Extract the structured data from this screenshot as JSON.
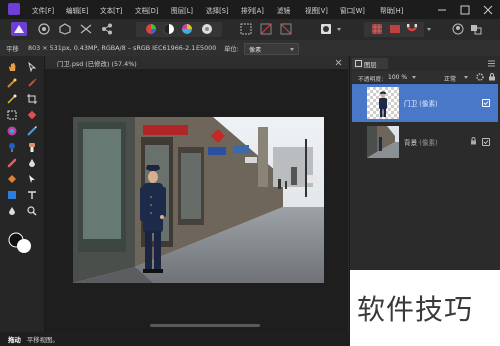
{
  "menubar": {
    "items": [
      "文件[F]",
      "编辑[E]",
      "文本[T]",
      "文档[D]",
      "图层[L]",
      "选择[S]",
      "排列[A]",
      "滤镜",
      "视图[V]",
      "窗口[W]",
      "帮助[H]"
    ]
  },
  "context_bar": {
    "tool_label": "平移",
    "doc_info": "803 × 531px, 0.43MP, RGBA/8 – sRGB IEC61966-2.1",
    "camera": "E5000",
    "units_label": "单位:",
    "units_value": "像素"
  },
  "document": {
    "tab_title": "门卫.psd (已修改) (57.4%)"
  },
  "layers_panel": {
    "tab_label": "图层",
    "opacity_label": "不透明度:",
    "opacity_value": "100 %",
    "blend_mode": "正常",
    "layers": [
      {
        "name": "门卫",
        "type": "(像素)",
        "selected": true
      },
      {
        "name": "背景",
        "type": "(像素)",
        "selected": false
      }
    ]
  },
  "statusbar": {
    "tool": "拖动",
    "hint": "平移视图。"
  },
  "watermark": {
    "text": "软件技巧"
  },
  "colors": {
    "accent": "#6e3fd6",
    "selection": "#4a78c8",
    "menubar_bg": "#1c1c1c"
  }
}
